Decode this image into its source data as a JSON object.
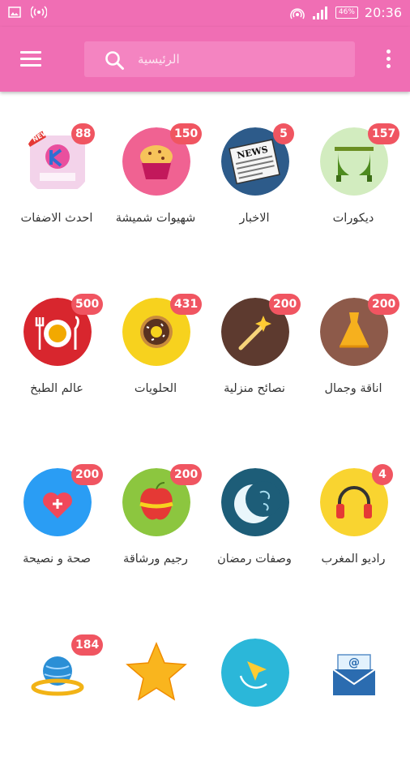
{
  "status_bar": {
    "time": "20:36",
    "battery": "46%",
    "icons": [
      "image-icon",
      "broadcast-icon",
      "hotspot-icon",
      "signal-icon",
      "battery-icon"
    ]
  },
  "app_bar": {
    "menu_icon": "hamburger-icon",
    "search_icon": "search-icon",
    "search_placeholder": "الرئيسية",
    "more_icon": "more-vert-icon",
    "colors": {
      "primary": "#f06eb4",
      "search_bg": "#f484c1",
      "badge": "#f05561"
    }
  },
  "categories": [
    {
      "label": "ديكورات",
      "badge": "157",
      "icon": "curtains-icon",
      "color": "#d2ecbf"
    },
    {
      "label": "الاخبار",
      "badge": "5",
      "icon": "newspaper-icon",
      "color": "#2d5b8a"
    },
    {
      "label": "شهيوات شميشة",
      "badge": "150",
      "icon": "muffin-icon",
      "color": "#f06292"
    },
    {
      "label": "احدث الاضفات",
      "badge": "88",
      "icon": "new-logo-icon",
      "color": "#ffffff"
    },
    {
      "label": "اناقة وجمال",
      "badge": "200",
      "icon": "dress-icon",
      "color": "#8d5a4a"
    },
    {
      "label": "نصائح منزلية",
      "badge": "200",
      "icon": "magic-wand-icon",
      "color": "#5d3a2f"
    },
    {
      "label": "الحلويات",
      "badge": "431",
      "icon": "donut-icon",
      "color": "#f7d21e"
    },
    {
      "label": "عالم الطبخ",
      "badge": "500",
      "icon": "plate-icon",
      "color": "#d8262e"
    },
    {
      "label": "راديو المغرب",
      "badge": "4",
      "icon": "headphones-icon",
      "color": "#f9d430"
    },
    {
      "label": "وصفات رمضان",
      "badge": "",
      "icon": "crescent-icon",
      "color": "#1d5d78"
    },
    {
      "label": "رجيم ورشاقة",
      "badge": "200",
      "icon": "apple-tape-icon",
      "color": "#8cc63f"
    },
    {
      "label": "صحة و نصيحة",
      "badge": "200",
      "icon": "heart-plus-icon",
      "color": "#2a9df4"
    },
    {
      "label": "",
      "badge": "",
      "icon": "email-icon",
      "color": "#ffffff"
    },
    {
      "label": "",
      "badge": "",
      "icon": "cursor-icon",
      "color": "#2bb7d9"
    },
    {
      "label": "",
      "badge": "",
      "icon": "star-icon",
      "color": "#ffffff"
    },
    {
      "label": "",
      "badge": "184",
      "icon": "globe-people-icon",
      "color": "#ffffff"
    }
  ]
}
